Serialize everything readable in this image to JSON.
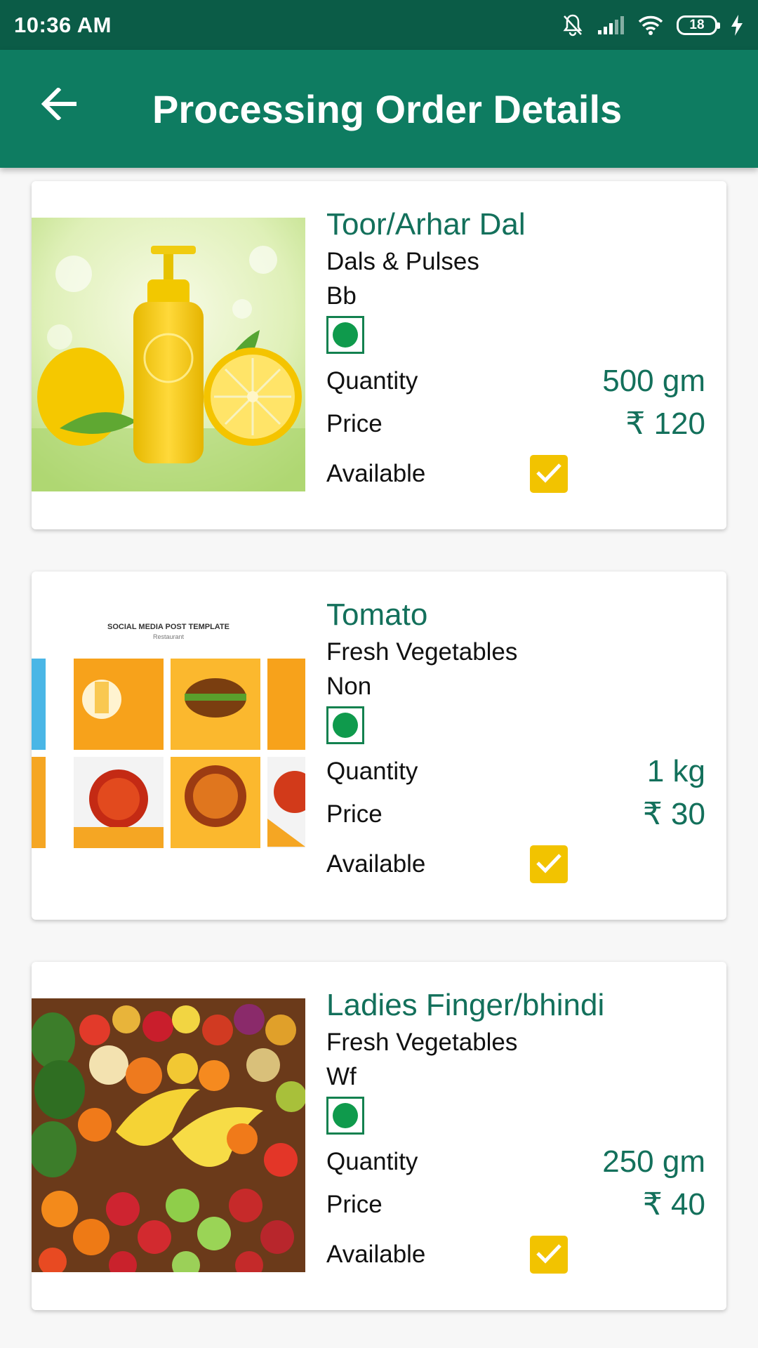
{
  "status_bar": {
    "time": "10:36 AM",
    "battery": "18",
    "icons": [
      "muted-bell-icon",
      "signal-icon",
      "wifi-icon",
      "battery-icon",
      "charging-icon"
    ]
  },
  "app_bar": {
    "title": "Processing Order Details",
    "back_icon": "arrow-left-icon"
  },
  "colors": {
    "status_bar": "#0b5c47",
    "app_bar": "#0e7c61",
    "accent_text": "#13705b",
    "checkbox": "#f2c300",
    "veg_mark": "#0f9a4c"
  },
  "items": [
    {
      "name": "Toor/Arhar Dal",
      "category": "Dals & Pulses",
      "brand": "Bb",
      "quantity_label": "Quantity",
      "quantity": "500 gm",
      "price_label": "Price",
      "price": "₹ 120",
      "available_label": "Available",
      "available": true,
      "image": "lemon-product-bottle-image"
    },
    {
      "name": "Tomato",
      "category": "Fresh Vegetables",
      "brand": "Non",
      "quantity_label": "Quantity",
      "quantity": "1 kg",
      "price_label": "Price",
      "price": "₹ 30",
      "available_label": "Available",
      "available": true,
      "image": "social-media-food-template-image",
      "image_text": [
        "SOCIAL MEDIA POST TEMPLATE",
        "Restaurant"
      ]
    },
    {
      "name": "Ladies Finger/bhindi",
      "category": "Fresh Vegetables",
      "brand": "Wf",
      "quantity_label": "Quantity",
      "quantity": "250 gm",
      "price_label": "Price",
      "price": "₹ 40",
      "available_label": "Available",
      "available": true,
      "image": "fruit-market-image"
    }
  ]
}
